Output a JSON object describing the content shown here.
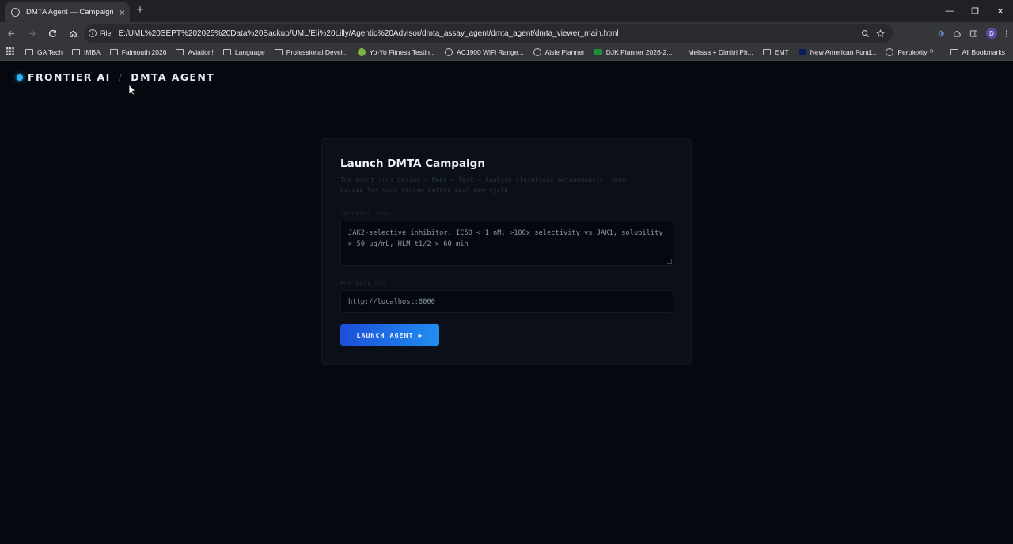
{
  "browser": {
    "tab_title": "DMTA Agent — Campaign Viewer",
    "tab_close": "×",
    "new_tab": "+",
    "chip": "File",
    "url": "E:/UML%20SEPT%202025%20Data%20Backup/UML/Eli%20Lilly/Agentic%20Advisor/dmta_assay_agent/dmta_agent/dmta_viewer_main.html",
    "avatar_initial": "D",
    "window_controls": [
      "—",
      "❐",
      "✕"
    ]
  },
  "bookmarks": {
    "items": [
      {
        "label": "GA Tech",
        "icon": "folder-icon"
      },
      {
        "label": "IMBA",
        "icon": "folder-icon"
      },
      {
        "label": "Falmouth 2026",
        "icon": "folder-icon"
      },
      {
        "label": "Aviation!",
        "icon": "folder-icon"
      },
      {
        "label": "Language",
        "icon": "folder-icon"
      },
      {
        "label": "Professional Devel...",
        "icon": "folder-icon"
      },
      {
        "label": "Yo-Yo Fitness Testin...",
        "icon": "yoyo-icon"
      },
      {
        "label": "AC1900 WiFi Range...",
        "icon": "globe-icon"
      },
      {
        "label": "Aisle Planner",
        "icon": "link-icon"
      },
      {
        "label": "DJK Planner 2026-2...",
        "icon": "sheets-icon"
      },
      {
        "label": "Melissa + Dimitri Ph...",
        "icon": "none"
      },
      {
        "label": "EMT",
        "icon": "folder-icon"
      },
      {
        "label": "New American Fund...",
        "icon": "naf-icon"
      },
      {
        "label": "Perplexity",
        "icon": "perplexity-icon"
      }
    ],
    "all_bookmarks": "All Bookmarks",
    "more": "»"
  },
  "brand": {
    "name": "FRONTIER AI",
    "separator": "/",
    "product": "DMTA AGENT"
  },
  "card": {
    "title": "Launch DMTA Campaign",
    "description": "The agent runs Design → Make → Test → Analyze iterations autonomously, then pauses for your review before each new cycle.",
    "goal_label": "CAMPAIGN GOAL",
    "goal_value": "JAK2-selective inhibitor: IC50 < 1 nM, >100x selectivity vs JAK1, solubility > 50 ug/mL, HLM t1/2 > 60 min",
    "api_label": "API BASE URL",
    "api_value": "http://localhost:8000",
    "launch_label": "LAUNCH AGENT ▶"
  },
  "colors": {
    "accent": "#1f8ff0",
    "accent_dark": "#1d4ed8",
    "brand_dot": "#29b6f6",
    "background": "#05080f"
  }
}
